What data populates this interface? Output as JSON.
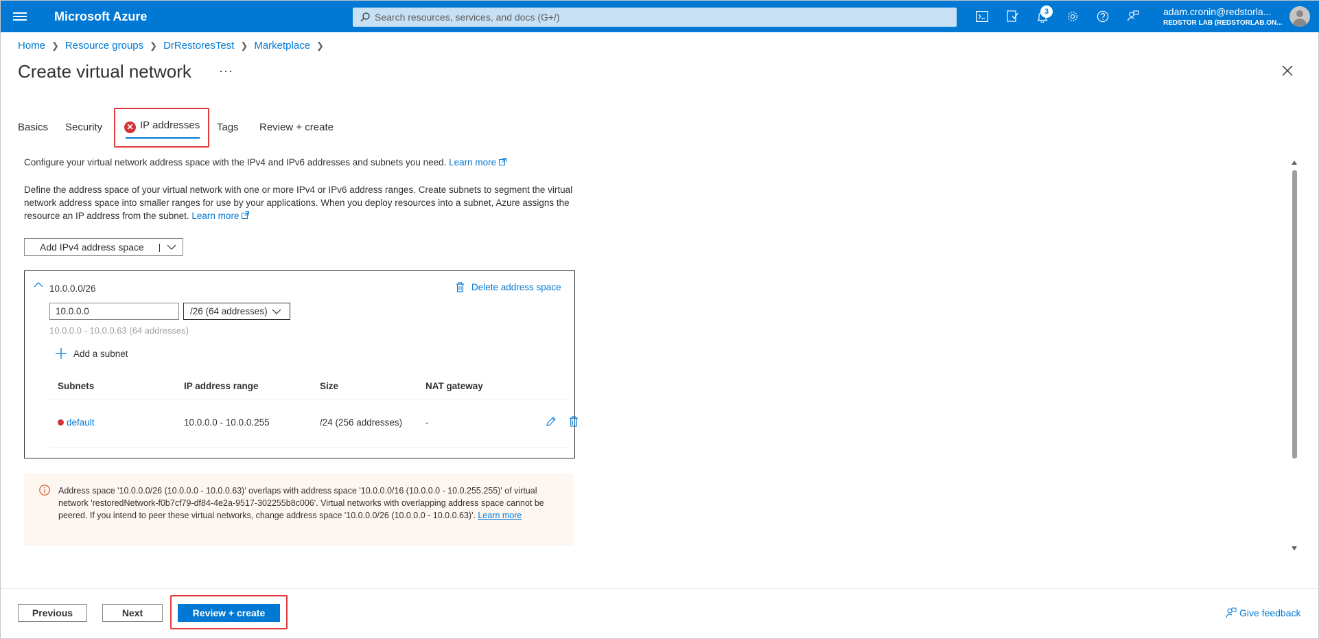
{
  "topbar": {
    "brand": "Microsoft Azure",
    "search_placeholder": "Search resources, services, and docs (G+/)",
    "notification_count": "3",
    "account_email": "adam.cronin@redstorla...",
    "account_org": "REDSTOR LAB (REDSTORLAB.ON...",
    "brand_color": "#0078d4"
  },
  "breadcrumb": [
    "Home",
    "Resource groups",
    "DrRestoresTest",
    "Marketplace"
  ],
  "page": {
    "title": "Create virtual network",
    "more_label": "···"
  },
  "tabs": {
    "basics": "Basics",
    "security": "Security",
    "ip_addresses": "IP addresses",
    "tags": "Tags",
    "review_create": "Review + create",
    "active": "IP addresses"
  },
  "intro": {
    "line1": "Configure your virtual network address space with the IPv4 and IPv6 addresses and subnets you need.",
    "learn_more_1": "Learn more",
    "para2": "Define the address space of your virtual network with one or more IPv4 or IPv6 address ranges. Create subnets to segment the virtual network address space into smaller ranges for use by your applications. When you deploy resources into a subnet, Azure assigns the resource an IP address from the subnet.",
    "learn_more_2": "Learn more"
  },
  "add_space_button": "Add IPv4 address space",
  "address_space": {
    "title": "10.0.0.0/26",
    "delete_label": "Delete address space",
    "ip_value": "10.0.0.0",
    "cidr_selected": "/26 (64 addresses)",
    "range_hint": "10.0.0.0 - 10.0.0.63 (64 addresses)",
    "add_subnet_label": "Add a subnet"
  },
  "subnet_table": {
    "headers": [
      "Subnets",
      "IP address range",
      "Size",
      "NAT gateway"
    ],
    "rows": [
      {
        "name": "default",
        "range": "10.0.0.0 - 10.0.0.255",
        "size": "/24 (256 addresses)",
        "nat": "-",
        "status": "error"
      }
    ]
  },
  "warning": {
    "text": "Address space '10.0.0.0/26 (10.0.0.0 - 10.0.0.63)' overlaps with address space '10.0.0.0/16 (10.0.0.0 - 10.0.255.255)' of virtual network 'restoredNetwork-f0b7cf79-df84-4e2a-9517-302255b8c006'. Virtual networks with overlapping address space cannot be peered. If you intend to peer these virtual networks, change address space '10.0.0.0/26 (10.0.0.0 - 10.0.0.63)'.",
    "link": "Learn more",
    "icon": "info-icon",
    "color": "#ca5010"
  },
  "footer": {
    "previous": "Previous",
    "next": "Next",
    "review_create": "Review + create",
    "feedback": "Give feedback"
  },
  "colors": {
    "error": "#d13438",
    "highlight_box": "#e03b3b",
    "link": "#0078d4"
  }
}
